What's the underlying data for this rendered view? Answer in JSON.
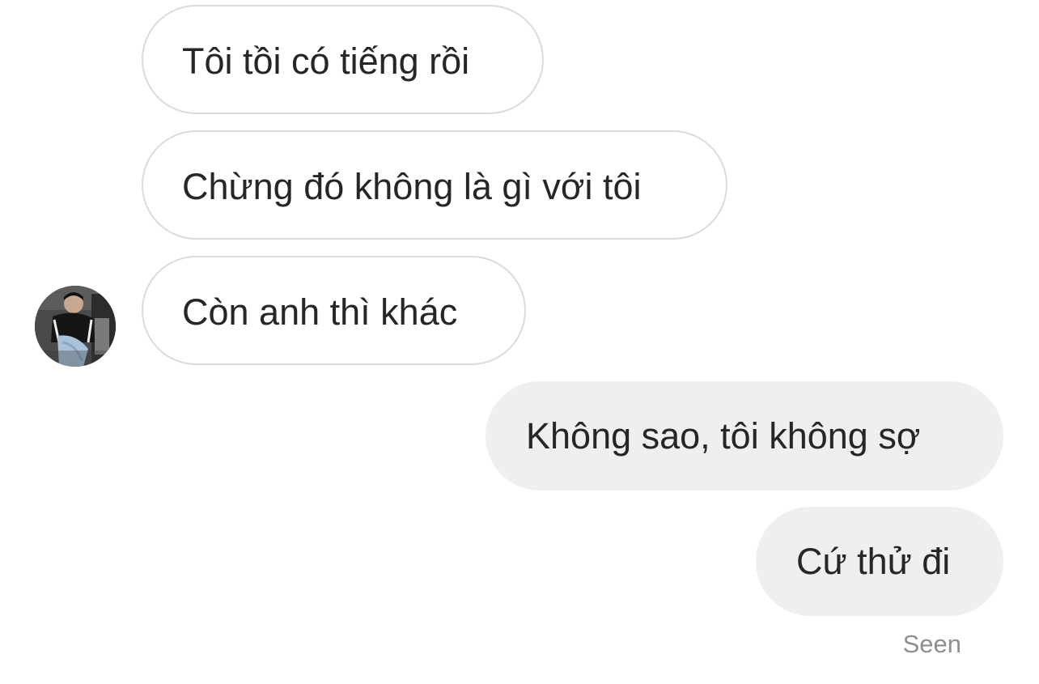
{
  "thread": {
    "messages": [
      {
        "direction": "incoming",
        "text": "Tôi tồi có tiếng rồi"
      },
      {
        "direction": "incoming",
        "text": "Chừng đó không là gì với tôi"
      },
      {
        "direction": "incoming",
        "text": "Còn anh thì khác"
      },
      {
        "direction": "outgoing",
        "text": "Không sao, tôi không sợ"
      },
      {
        "direction": "outgoing",
        "text": "Cứ thử đi"
      }
    ],
    "status": "Seen"
  },
  "colors": {
    "incoming_bubble": "#ffffff",
    "incoming_border": "#dbdbdb",
    "outgoing_bubble": "#efefef",
    "text": "#262626",
    "status_text": "#8e8e8e"
  }
}
